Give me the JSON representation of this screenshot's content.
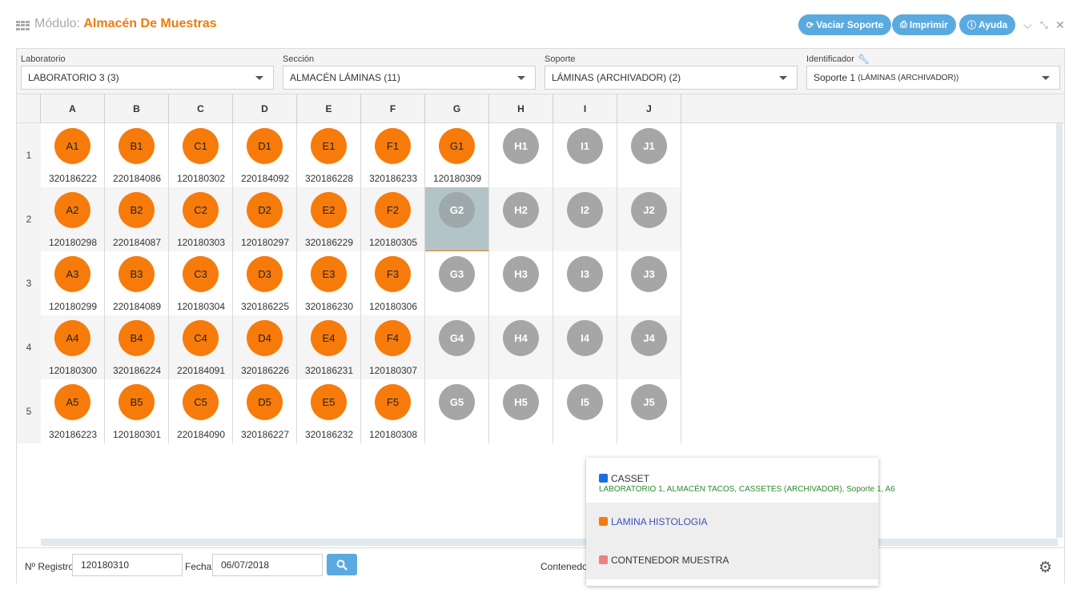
{
  "header": {
    "module_label": "Módulo:",
    "module_name": "Almacén De Muestras",
    "buttons": {
      "vaciar": "Vaciar Soporte",
      "imprimir": "Imprimir",
      "ayuda": "Ayuda"
    },
    "window_icons": [
      "chevron-down-icon",
      "minimize-arrows-icon",
      "close-icon"
    ]
  },
  "filters": {
    "laboratorio": {
      "label": "Laboratorio",
      "value": "LABORATORIO 3 (3)"
    },
    "seccion": {
      "label": "Sección",
      "value": "ALMACÉN LÁMINAS (11)"
    },
    "soporte": {
      "label": "Soporte",
      "value": "LÁMINAS (ARCHIVADOR) (2)"
    },
    "identificador": {
      "label": "Identificador",
      "value_main": "Soporte 1",
      "value_sub": "(LÁMINAS (ARCHIVADOR))"
    }
  },
  "grid": {
    "columns": [
      "A",
      "B",
      "C",
      "D",
      "E",
      "F",
      "G",
      "H",
      "I",
      "J"
    ],
    "rows": [
      "1",
      "2",
      "3",
      "4",
      "5"
    ],
    "selected_cell": "G2",
    "colors": {
      "occupied": "#f77b0b",
      "empty": "#a6a6a6",
      "selected_bg": "#b3c4c8"
    },
    "cells": [
      [
        {
          "label": "A1",
          "code": "320186222",
          "status": "occupied"
        },
        {
          "label": "B1",
          "code": "220184086",
          "status": "occupied"
        },
        {
          "label": "C1",
          "code": "120180302",
          "status": "occupied"
        },
        {
          "label": "D1",
          "code": "220184092",
          "status": "occupied"
        },
        {
          "label": "E1",
          "code": "320186228",
          "status": "occupied"
        },
        {
          "label": "F1",
          "code": "320186233",
          "status": "occupied"
        },
        {
          "label": "G1",
          "code": "120180309",
          "status": "occupied"
        },
        {
          "label": "H1",
          "code": "",
          "status": "empty"
        },
        {
          "label": "I1",
          "code": "",
          "status": "empty"
        },
        {
          "label": "J1",
          "code": "",
          "status": "empty"
        }
      ],
      [
        {
          "label": "A2",
          "code": "120180298",
          "status": "occupied"
        },
        {
          "label": "B2",
          "code": "220184087",
          "status": "occupied"
        },
        {
          "label": "C2",
          "code": "120180303",
          "status": "occupied"
        },
        {
          "label": "D2",
          "code": "120180297",
          "status": "occupied"
        },
        {
          "label": "E2",
          "code": "320186229",
          "status": "occupied"
        },
        {
          "label": "F2",
          "code": "120180305",
          "status": "occupied"
        },
        {
          "label": "G2",
          "code": "",
          "status": "selected"
        },
        {
          "label": "H2",
          "code": "",
          "status": "empty"
        },
        {
          "label": "I2",
          "code": "",
          "status": "empty"
        },
        {
          "label": "J2",
          "code": "",
          "status": "empty"
        }
      ],
      [
        {
          "label": "A3",
          "code": "120180299",
          "status": "occupied"
        },
        {
          "label": "B3",
          "code": "220184089",
          "status": "occupied"
        },
        {
          "label": "C3",
          "code": "120180304",
          "status": "occupied"
        },
        {
          "label": "D3",
          "code": "320186225",
          "status": "occupied"
        },
        {
          "label": "E3",
          "code": "320186230",
          "status": "occupied"
        },
        {
          "label": "F3",
          "code": "120180306",
          "status": "occupied"
        },
        {
          "label": "G3",
          "code": "",
          "status": "empty"
        },
        {
          "label": "H3",
          "code": "",
          "status": "empty"
        },
        {
          "label": "I3",
          "code": "",
          "status": "empty"
        },
        {
          "label": "J3",
          "code": "",
          "status": "empty"
        }
      ],
      [
        {
          "label": "A4",
          "code": "120180300",
          "status": "occupied"
        },
        {
          "label": "B4",
          "code": "320186224",
          "status": "occupied"
        },
        {
          "label": "C4",
          "code": "220184091",
          "status": "occupied"
        },
        {
          "label": "D4",
          "code": "320186226",
          "status": "occupied"
        },
        {
          "label": "E4",
          "code": "320186231",
          "status": "occupied"
        },
        {
          "label": "F4",
          "code": "120180307",
          "status": "occupied"
        },
        {
          "label": "G4",
          "code": "",
          "status": "empty"
        },
        {
          "label": "H4",
          "code": "",
          "status": "empty"
        },
        {
          "label": "I4",
          "code": "",
          "status": "empty"
        },
        {
          "label": "J4",
          "code": "",
          "status": "empty"
        }
      ],
      [
        {
          "label": "A5",
          "code": "320186223",
          "status": "occupied"
        },
        {
          "label": "B5",
          "code": "120180301",
          "status": "occupied"
        },
        {
          "label": "C5",
          "code": "220184090",
          "status": "occupied"
        },
        {
          "label": "D5",
          "code": "320186227",
          "status": "occupied"
        },
        {
          "label": "E5",
          "code": "320186232",
          "status": "occupied"
        },
        {
          "label": "F5",
          "code": "120180308",
          "status": "occupied"
        },
        {
          "label": "G5",
          "code": "",
          "status": "empty"
        },
        {
          "label": "H5",
          "code": "",
          "status": "empty"
        },
        {
          "label": "I5",
          "code": "",
          "status": "empty"
        },
        {
          "label": "J5",
          "code": "",
          "status": "empty"
        }
      ]
    ]
  },
  "footer": {
    "registro_label": "Nº Registro",
    "registro_value": "120180310",
    "fecha_label": "Fecha",
    "fecha_value": "06/07/2018",
    "contenedor_label": "Contenedore"
  },
  "dropdown": {
    "items": [
      {
        "name": "CASSET",
        "color": "#1a6fe0",
        "sub": "LABORATORIO 1, ALMACÉN TACOS, CASSETES (ARCHIVADOR), Soporte 1, A6"
      },
      {
        "name": "LAMINA HISTOLOGIA",
        "color": "#f77b0b",
        "name_color": "#3f51b5"
      },
      {
        "name": "CONTENEDOR MUESTRA",
        "color": "#f08080"
      }
    ]
  }
}
